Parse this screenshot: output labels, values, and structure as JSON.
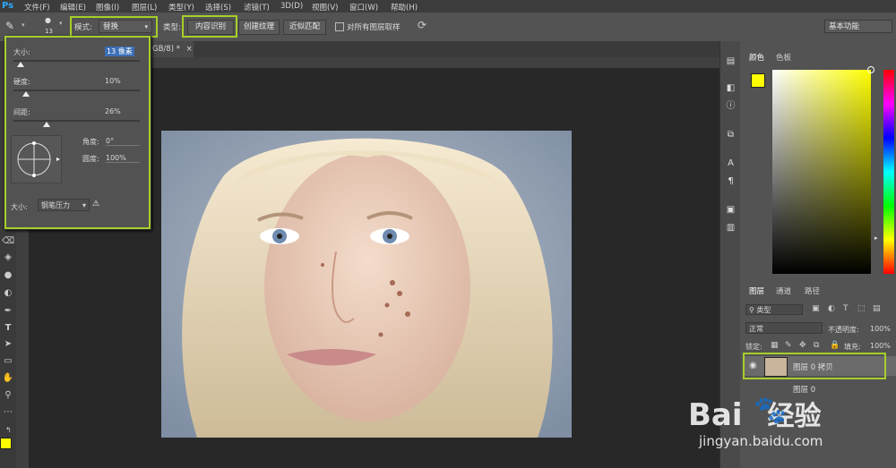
{
  "menu": {
    "app_logo": "Ps",
    "items": [
      "文件(F)",
      "编辑(E)",
      "图像(I)",
      "图层(L)",
      "类型(Y)",
      "选择(S)",
      "滤镜(T)",
      "3D(D)",
      "视图(V)",
      "窗口(W)",
      "帮助(H)"
    ]
  },
  "options": {
    "brush_size_small": "13",
    "mode_label": "模式:",
    "mode_value": "替换",
    "type_label": "类型:",
    "content_aware": "内容识别",
    "create_texture": "创建纹理",
    "proximity_match": "近似匹配",
    "sample_all_layers": "对所有图层取样",
    "workspace": "基本功能"
  },
  "document": {
    "tab_title": "GB/8) *",
    "close": "×"
  },
  "brush_panel": {
    "size_label": "大小:",
    "size_value": "13 像素",
    "hardness_label": "硬度:",
    "hardness_value": "10%",
    "hardness_level": 0.1,
    "spacing_label": "间距:",
    "spacing_value": "26%",
    "spacing_level": 0.26,
    "angle_label": "角度:",
    "angle_value": "0°",
    "roundness_label": "圆度:",
    "roundness_value": "100%",
    "pressure_label": "大小:",
    "pressure_value": "钢笔压力"
  },
  "color_panel": {
    "tab_color": "颜色",
    "tab_swatches": "色板",
    "foreground": "#ffff00",
    "background": "#ffffff"
  },
  "layers_panel": {
    "tabs": [
      "图层",
      "通道",
      "路径"
    ],
    "filter_label": "类型",
    "blend_mode": "正常",
    "opacity_label": "不透明度:",
    "opacity_value": "100%",
    "lock_label": "锁定:",
    "fill_label": "填充:",
    "fill_value": "100%",
    "layers": [
      {
        "name": "图层 0 拷贝",
        "selected": true
      },
      {
        "name": "图层 0",
        "selected": false
      }
    ]
  },
  "watermark": {
    "brand": "Bai",
    "brand2": "经验",
    "url": "jingyan.baidu.com"
  },
  "colors": {
    "highlight": "#a6cf2a",
    "accent_blue": "#31a8ff"
  }
}
